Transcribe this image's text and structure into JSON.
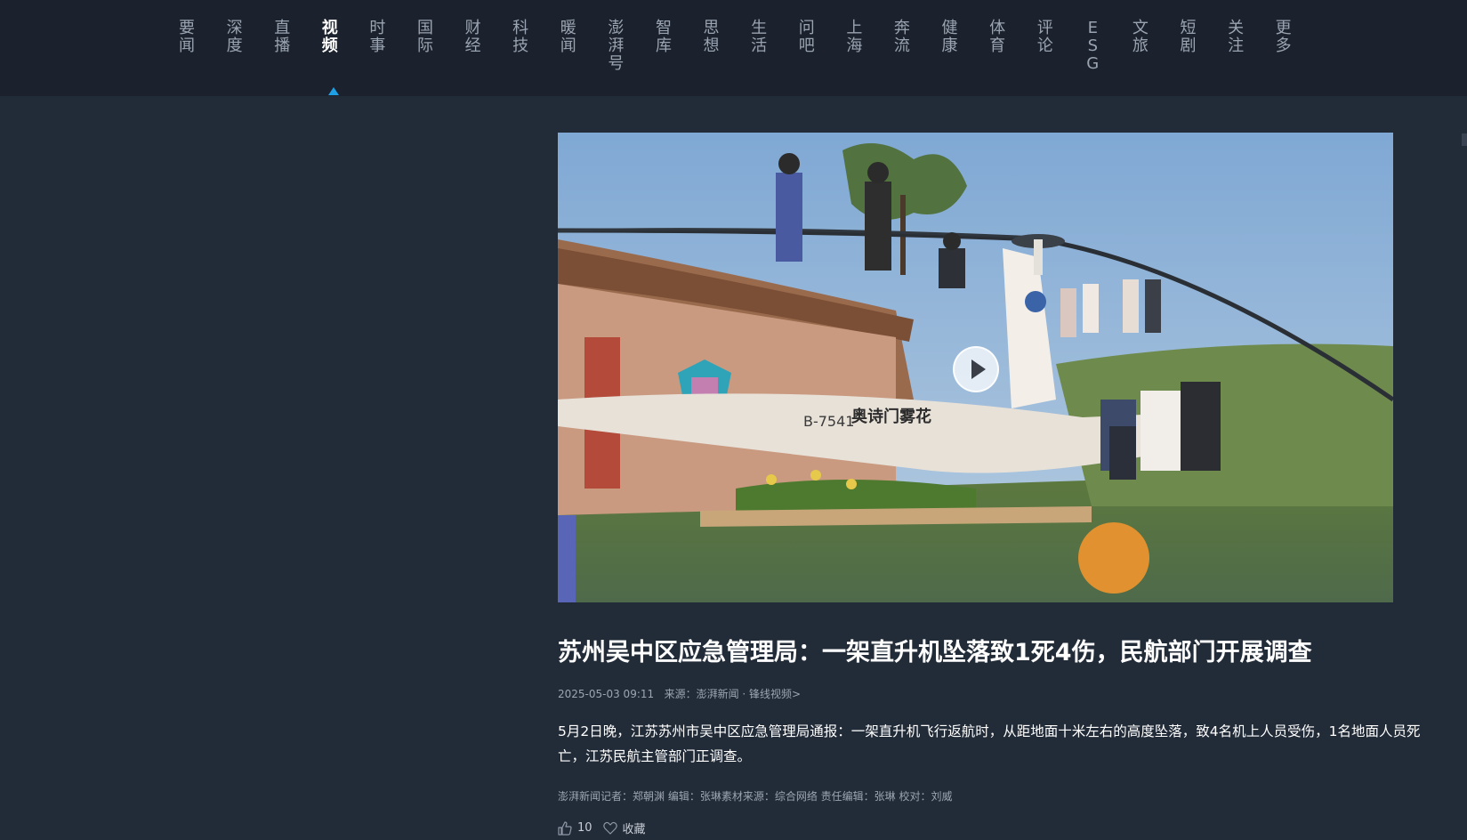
{
  "nav": {
    "items": [
      {
        "label": "要闻"
      },
      {
        "label": "深度"
      },
      {
        "label": "直播"
      },
      {
        "label": "视频",
        "active": true
      },
      {
        "label": "时事"
      },
      {
        "label": "国际"
      },
      {
        "label": "财经"
      },
      {
        "label": "科技"
      },
      {
        "label": "暖闻"
      },
      {
        "label": "澎湃号"
      },
      {
        "label": "智库"
      },
      {
        "label": "思想"
      },
      {
        "label": "生活"
      },
      {
        "label": "问吧"
      },
      {
        "label": "上海"
      },
      {
        "label": "奔流"
      },
      {
        "label": "健康"
      },
      {
        "label": "体育"
      },
      {
        "label": "评论"
      },
      {
        "label": "ESG"
      },
      {
        "label": "文旅"
      },
      {
        "label": "短剧"
      },
      {
        "label": "关注"
      },
      {
        "label": "更多"
      }
    ]
  },
  "video": {
    "registration": "B-7541",
    "livery_text": "奥诗门雾花",
    "play_icon": "play-icon"
  },
  "article": {
    "title": "苏州吴中区应急管理局：一架直升机坠落致1死4伤，民航部门开展调查",
    "datetime": "2025-05-03 09:11",
    "source_label": "来源：",
    "source_link": "澎湃新闻 · 锋线视频>",
    "summary": "5月2日晚，江苏苏州市吴中区应急管理局通报：一架直升机飞行返航时，从距地面十米左右的高度坠落，致4名机上人员受伤，1名地面人员死亡，江苏民航主管部门正调查。",
    "credits": "澎湃新闻记者：郑朝渊 编辑：张琳素材来源：综合网络  责任编辑：张琳  校对：刘威",
    "likes": "10",
    "favorite_label": "收藏"
  },
  "colors": {
    "page_bg": "#222b38",
    "nav_bg": "#1b222d",
    "accent": "#1ea0e6"
  }
}
